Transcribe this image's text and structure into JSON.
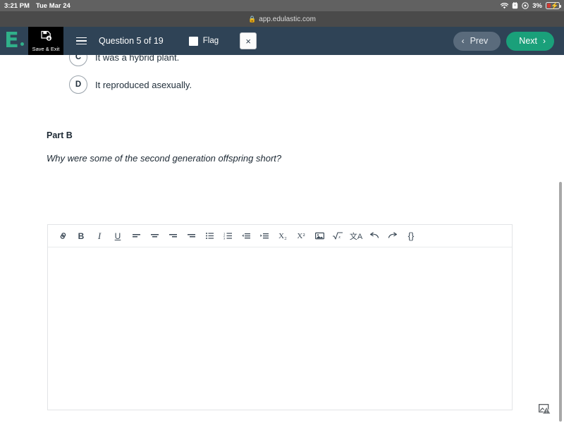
{
  "status_bar": {
    "time": "3:21 PM",
    "date": "Tue Mar 24",
    "battery_percent": "3%",
    "icons": [
      "wifi-icon",
      "alarm-icon",
      "do-not-disturb-icon",
      "battery-charging-icon"
    ],
    "background_color": "#616161"
  },
  "browser": {
    "lock_icon": "lock-icon",
    "url": "app.edulastic.com"
  },
  "header": {
    "logo_letter": "E",
    "save_exit_label": "Save & Exit",
    "save_exit_icon": "save-document-icon",
    "menu_icon": "hamburger-menu-icon",
    "question_counter": "Question 5 of 19",
    "flag_label": "Flag",
    "flag_checked": false,
    "close_label": "×",
    "prev_label": "Prev",
    "next_label": "Next",
    "prev_chevron": "‹",
    "next_chevron": "›",
    "background_color": "#2f4356",
    "accent_green": "#1aa07a"
  },
  "question": {
    "options": [
      {
        "letter": "C",
        "text": "It was a hybrid plant."
      },
      {
        "letter": "D",
        "text": "It reproduced asexually."
      }
    ],
    "part_label": "Part B",
    "part_question": "Why were some of the second generation offspring short?"
  },
  "editor": {
    "content": "",
    "placeholder": "",
    "toolbar": [
      {
        "name": "link-icon",
        "glyph": "∞"
      },
      {
        "name": "bold-icon",
        "glyph": "B"
      },
      {
        "name": "italic-icon",
        "glyph": "I"
      },
      {
        "name": "underline-icon",
        "glyph": "U"
      },
      {
        "name": "align-left-icon",
        "glyph": ""
      },
      {
        "name": "align-center-icon",
        "glyph": ""
      },
      {
        "name": "align-right-icon",
        "glyph": ""
      },
      {
        "name": "justify-icon",
        "glyph": ""
      },
      {
        "name": "bullet-list-icon",
        "glyph": ""
      },
      {
        "name": "numbered-list-icon",
        "glyph": ""
      },
      {
        "name": "outdent-icon",
        "glyph": ""
      },
      {
        "name": "indent-icon",
        "glyph": ""
      },
      {
        "name": "subscript-icon",
        "glyph": "X₂"
      },
      {
        "name": "superscript-icon",
        "glyph": "X²"
      },
      {
        "name": "insert-image-icon",
        "glyph": ""
      },
      {
        "name": "math-formula-icon",
        "glyph": "√x"
      },
      {
        "name": "special-characters-icon",
        "glyph": "文A"
      },
      {
        "name": "undo-icon",
        "glyph": "↩"
      },
      {
        "name": "redo-icon",
        "glyph": "↪"
      },
      {
        "name": "source-code-icon",
        "glyph": "{}"
      }
    ]
  },
  "footer": {
    "broken_image_icon": "broken-image-icon"
  },
  "scrollbar": {
    "orientation": "vertical",
    "thumb_color": "#a8a8a8"
  }
}
